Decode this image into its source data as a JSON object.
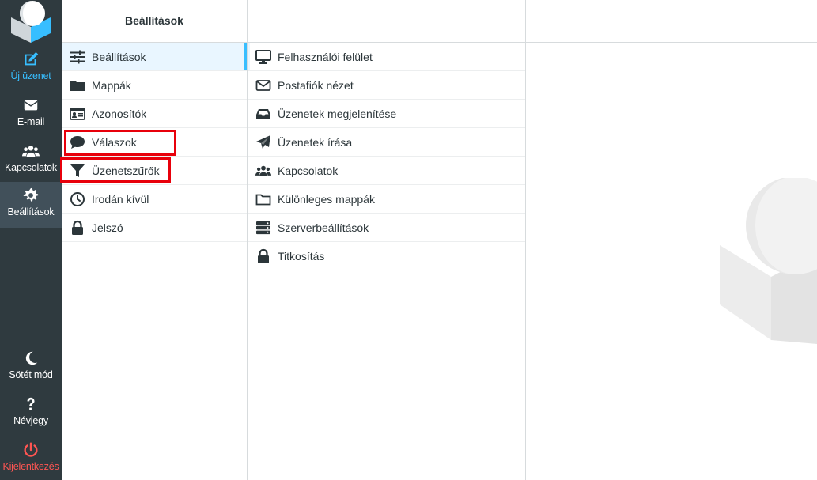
{
  "colors": {
    "rail_bg": "#2f3a3f",
    "accent": "#37beff",
    "danger": "#ff5552",
    "highlight_box": "#e8000b"
  },
  "rail": {
    "compose": {
      "label": "Új üzenet",
      "icon": "compose-icon"
    },
    "mail": {
      "label": "E-mail",
      "icon": "envelope-icon"
    },
    "contacts": {
      "label": "Kapcsolatok",
      "icon": "users-icon"
    },
    "settings": {
      "label": "Beállítások",
      "icon": "gear-icon"
    },
    "dark_mode": {
      "label": "Sötét mód",
      "icon": "moon-icon"
    },
    "about": {
      "label": "Névjegy",
      "icon": "question-icon"
    },
    "logout": {
      "label": "Kijelentkezés",
      "icon": "power-icon"
    }
  },
  "settings_menu": {
    "header": "Beállítások",
    "items": [
      {
        "label": "Beállítások",
        "icon": "sliders-icon"
      },
      {
        "label": "Mappák",
        "icon": "folder-icon"
      },
      {
        "label": "Azonosítók",
        "icon": "id-card-icon"
      },
      {
        "label": "Válaszok",
        "icon": "comment-icon"
      },
      {
        "label": "Üzenetszűrők",
        "icon": "filter-icon"
      },
      {
        "label": "Irodán kívül",
        "icon": "clock-icon"
      },
      {
        "label": "Jelszó",
        "icon": "lock-icon"
      }
    ]
  },
  "sections": {
    "items": [
      {
        "label": "Felhasználói felület",
        "icon": "monitor-icon"
      },
      {
        "label": "Postafiók nézet",
        "icon": "envelope-outline-icon"
      },
      {
        "label": "Üzenetek megjelenítése",
        "icon": "inbox-icon"
      },
      {
        "label": "Üzenetek írása",
        "icon": "paper-plane-icon"
      },
      {
        "label": "Kapcsolatok",
        "icon": "users-icon"
      },
      {
        "label": "Különleges mappák",
        "icon": "folder-outline-icon"
      },
      {
        "label": "Szerverbeállítások",
        "icon": "server-icon"
      },
      {
        "label": "Titkosítás",
        "icon": "lock-icon"
      }
    ]
  }
}
